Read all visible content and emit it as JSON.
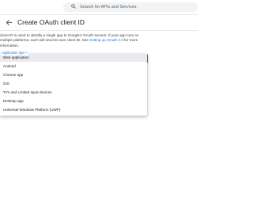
{
  "search": {
    "placeholder": "Search for APIs and Services"
  },
  "header": {
    "title": "Create OAuth client ID"
  },
  "description": {
    "text_1": "client ID is used to identify a single app to Google's OAuth servers. If your app runs on",
    "text_2": "multiple platforms, each will need its own client ID. See",
    "link": "Setting up OAuth 2.0",
    "text_3": "for more",
    "text_4": "information."
  },
  "form": {
    "application_type_label": "Application type *",
    "options": [
      "Web application",
      "Android",
      "Chrome app",
      "iOS",
      "TVs and Limited Input devices",
      "Desktop app",
      "Universal Windows Platform (UWP)"
    ],
    "selected_index": 0
  },
  "colors": {
    "accent": "#1a73e8",
    "text": "#202124",
    "selected_bg": "#e8eaed"
  },
  "icons": [
    "search-icon",
    "back-arrow-icon",
    "dropdown-arrow-icon"
  ]
}
